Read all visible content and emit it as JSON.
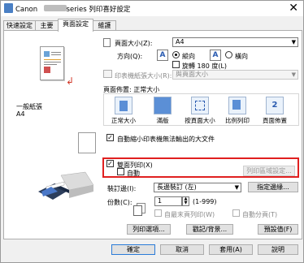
{
  "window": {
    "title_prefix": "Canon",
    "title_suffix": "series 列印喜好設定",
    "close": "✕"
  },
  "tabs": [
    {
      "label": "快速設定"
    },
    {
      "label": "主要"
    },
    {
      "label": "頁面設定"
    },
    {
      "label": "維護"
    }
  ],
  "active_tab": "頁面設定",
  "left": {
    "paper_label": "一般紙張",
    "paper_size": "A4"
  },
  "page_size": {
    "label": "頁面大小(Z):",
    "value": "A4"
  },
  "orientation": {
    "label": "方向(Q):",
    "portrait": "縱向",
    "landscape": "橫向",
    "rotate": "旋轉 180 度(L)"
  },
  "printer_paper_size": {
    "label": "印表機紙張大小(R):",
    "value": "與頁面大小"
  },
  "page_layout": {
    "label": "頁面佈置:",
    "current": "正常大小",
    "items": [
      {
        "label": "正常大小",
        "glyph": ""
      },
      {
        "label": "滿版",
        "glyph": ""
      },
      {
        "label": "按頁面大小",
        "glyph": ""
      },
      {
        "label": "比例列印",
        "glyph": ""
      },
      {
        "label": "頁面佈置",
        "glyph": "2"
      }
    ]
  },
  "auto_reduce": {
    "label": "自動縮小印表機無法輸出的大文件",
    "checked": "✓"
  },
  "duplex": {
    "label": "雙面列印(X)",
    "checked": "✓",
    "auto_label": "自動",
    "settings_button": "列印區域設定..."
  },
  "stapling": {
    "label": "裝訂邊(I):",
    "value": "長邊裝訂 (左)",
    "margin_button": "指定邊緣..."
  },
  "copies": {
    "label": "份數(C):",
    "value": "1",
    "range": "(1-999)",
    "reverse": "自最末頁列印(W)",
    "collate": "自動分頁(T)"
  },
  "bottom_buttons": {
    "print_options": "列印選項...",
    "stamp": "戳記/背景...",
    "defaults": "預設值(F)"
  },
  "dialog_buttons": {
    "ok": "確定",
    "cancel": "取消",
    "apply": "套用(A)",
    "help": "說明"
  },
  "colors": {
    "highlight": "#e02020",
    "accent": "#2a5bb0"
  }
}
